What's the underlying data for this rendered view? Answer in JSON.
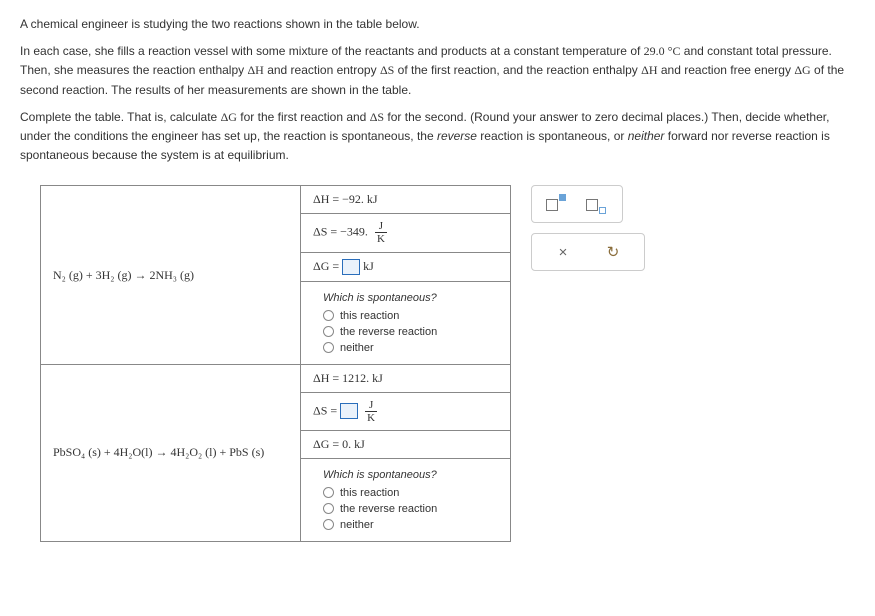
{
  "problem": {
    "p1": "A chemical engineer is studying the two reactions shown in the table below.",
    "p2_a": "In each case, she fills a reaction vessel with some mixture of the reactants and products at a constant temperature of ",
    "p2_temp": "29.0 °C",
    "p2_b": " and constant total pressure. Then, she measures the reaction enthalpy ",
    "p2_c": " and reaction entropy ",
    "p2_d": " of the first reaction, and the reaction enthalpy ",
    "p2_e": " and reaction free energy ",
    "p2_f": " of the second reaction. The results of her measurements are shown in the table.",
    "p3_a": "Complete the table. That is, calculate ",
    "p3_b": " for the first reaction and ",
    "p3_c": " for the second. (Round your answer to zero decimal places.) Then, decide whether, under the conditions the engineer has set up, the reaction is spontaneous, the ",
    "p3_rev": "reverse",
    "p3_d": " reaction is spontaneous, or ",
    "p3_neither": "neither",
    "p3_e": " forward nor reverse reaction is spontaneous because the system is at equilibrium.",
    "dH": "ΔH",
    "dS": "ΔS",
    "dG": "ΔG"
  },
  "reactions": {
    "r1": {
      "equation": "N₂ (g) + 3H₂ (g) → 2NH₃ (g)",
      "dH": "ΔH = −92. kJ",
      "dS_lhs": "ΔS = −349.",
      "frac_num": "J",
      "frac_den": "K",
      "dG_lhs": "ΔG = ",
      "dG_unit": " kJ"
    },
    "r2": {
      "equation": "PbSO₄ (s) + 4H₂O(l) → 4H₂O₂ (l) + PbS (s)",
      "dH": "ΔH = 1212. kJ",
      "dS_lhs": "ΔS = ",
      "frac_num": "J",
      "frac_den": "K",
      "dG": "ΔG = 0. kJ"
    }
  },
  "spont": {
    "question": "Which is spontaneous?",
    "opt1": "this reaction",
    "opt2": "the reverse reaction",
    "opt3": "neither"
  },
  "toolbar": {
    "close": "×",
    "reset": "↻"
  }
}
